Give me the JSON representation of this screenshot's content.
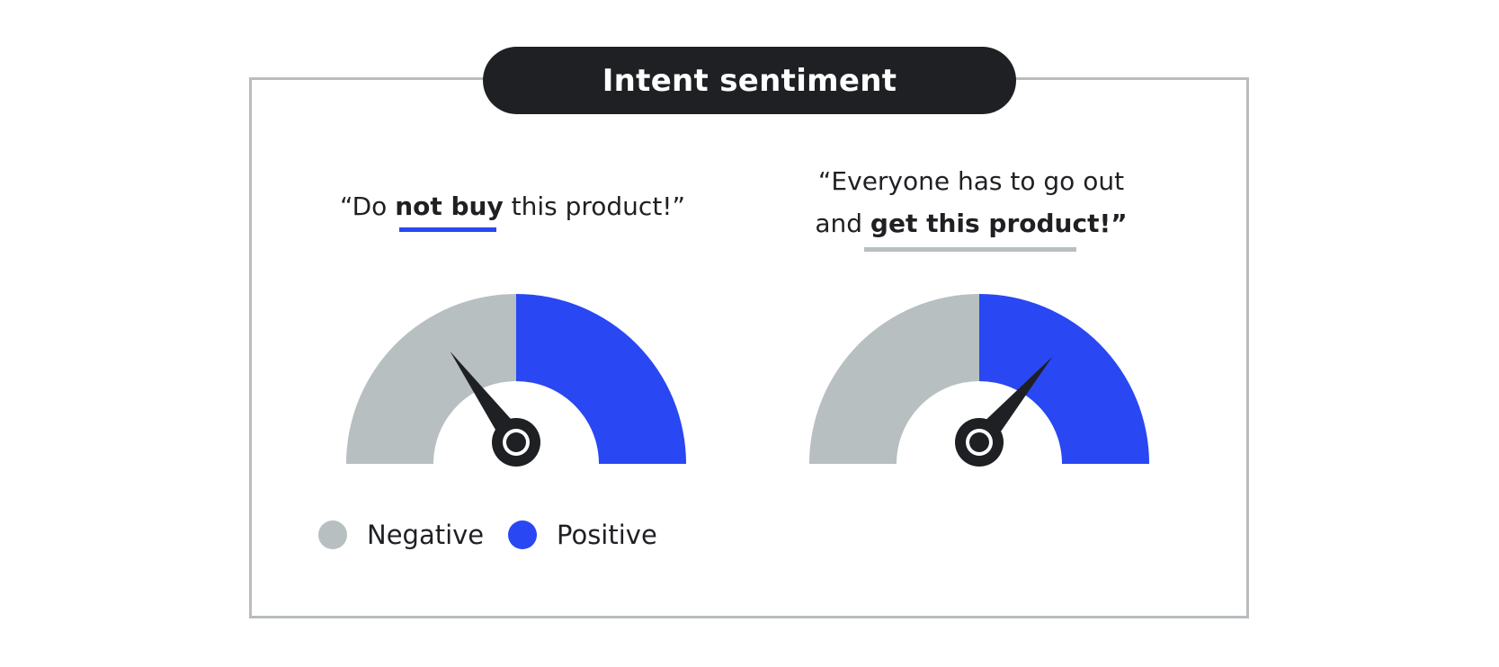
{
  "title": "Intent sentiment",
  "quotes": [
    {
      "line1_pre": "“Do ",
      "line1_bold": "not buy",
      "line1_post": " this product!”",
      "gauge_value": -0.4
    },
    {
      "line1": "“Everyone has to go out",
      "line2_pre": "and ",
      "line2_bold": "get this product!”",
      "gauge_value": 0.45
    }
  ],
  "legend": [
    {
      "label": "Negative",
      "color": "#b8bfc1"
    },
    {
      "label": "Positive",
      "color": "#2947f2"
    }
  ],
  "colors": {
    "negative": "#b8bfc1",
    "positive": "#2947f2",
    "needle": "#1f2023",
    "underline_negative": "#2947f2",
    "underline_positive": "#b8bfc1"
  }
}
